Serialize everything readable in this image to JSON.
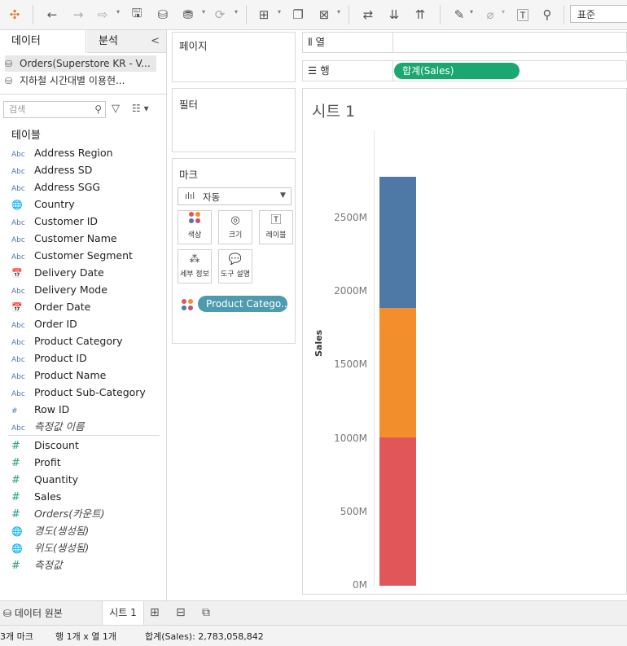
{
  "toolbar": {
    "font_select": "표준",
    "icons": [
      "tableau-logo-icon",
      "back-icon",
      "forward-icon",
      "redo-icon",
      "save-icon",
      "new-datasource-icon",
      "pause-updates-icon",
      "refresh-icon",
      "new-worksheet-icon",
      "duplicate-icon",
      "clear-sheet-icon",
      "swap-icon",
      "sort-asc-icon",
      "sort-desc-icon",
      "highlight-icon",
      "group-icon",
      "labels-icon",
      "pin-icon"
    ]
  },
  "datapane": {
    "tab_data": "데이터",
    "tab_analysis": "분석",
    "collapse": "<",
    "datasources": [
      "Orders(Superstore KR - V...",
      "지하철 시간대별 이용현..."
    ],
    "search_placeholder": "검색",
    "section_tables": "테이블",
    "dimensions": [
      {
        "icon": "Abc",
        "name": "Address Region"
      },
      {
        "icon": "Abc",
        "name": "Address SD"
      },
      {
        "icon": "Abc",
        "name": "Address SGG"
      },
      {
        "icon": "globe",
        "name": "Country"
      },
      {
        "icon": "Abc",
        "name": "Customer ID"
      },
      {
        "icon": "Abc",
        "name": "Customer Name"
      },
      {
        "icon": "Abc",
        "name": "Customer Segment"
      },
      {
        "icon": "calendar",
        "name": "Delivery Date"
      },
      {
        "icon": "Abc",
        "name": "Delivery Mode"
      },
      {
        "icon": "calendar",
        "name": "Order Date"
      },
      {
        "icon": "Abc",
        "name": "Order ID"
      },
      {
        "icon": "Abc",
        "name": "Product Category"
      },
      {
        "icon": "Abc",
        "name": "Product ID"
      },
      {
        "icon": "Abc",
        "name": "Product Name"
      },
      {
        "icon": "Abc",
        "name": "Product Sub-Category"
      },
      {
        "icon": "#",
        "name": "Row ID"
      },
      {
        "icon": "Abc",
        "name": "측정값 이름",
        "italic": true
      }
    ],
    "measures": [
      {
        "icon": "#",
        "name": "Discount"
      },
      {
        "icon": "#",
        "name": "Profit"
      },
      {
        "icon": "#",
        "name": "Quantity"
      },
      {
        "icon": "#",
        "name": "Sales"
      },
      {
        "icon": "#",
        "name": "Orders(카운트)",
        "italic": true
      },
      {
        "icon": "globe",
        "name": "경도(생성됨)",
        "italic": true
      },
      {
        "icon": "globe",
        "name": "위도(생성됨)",
        "italic": true
      },
      {
        "icon": "#",
        "name": "측정값",
        "italic": true
      }
    ]
  },
  "shelves": {
    "pages": "페이지",
    "filters": "필터",
    "marks": "마크",
    "mark_type": "자동",
    "mark_buttons": [
      "색상",
      "크기",
      "레이블",
      "세부 정보",
      "도구 설명"
    ],
    "color_pill": "Product Catego..",
    "columns_label": "열",
    "rows_label": "행",
    "rows_pill": "합계(Sales)"
  },
  "view": {
    "sheet_title": "시트 1"
  },
  "chart_data": {
    "type": "bar",
    "stacked": true,
    "ylabel": "Sales",
    "ylim": [
      0,
      2850000000
    ],
    "yticks": [
      "0M",
      "500M",
      "1000M",
      "1500M",
      "2000M",
      "2500M"
    ],
    "ytick_values": [
      0,
      500000000,
      1000000000,
      1500000000,
      2000000000,
      2500000000
    ],
    "series": [
      {
        "color": "#e15759",
        "value": 1010000000
      },
      {
        "color": "#f28e2b",
        "value": 880000000
      },
      {
        "color": "#4e79a7",
        "value": 893058842
      }
    ],
    "total": 2783058842
  },
  "bottom": {
    "datasource_tab": "데이터 원본",
    "sheet_tab": "시트 1"
  },
  "status": {
    "marks": "3개 마크",
    "rows_cols": "행 1개 x 열 1개",
    "sum": "합계(Sales): 2,783,058,842"
  }
}
